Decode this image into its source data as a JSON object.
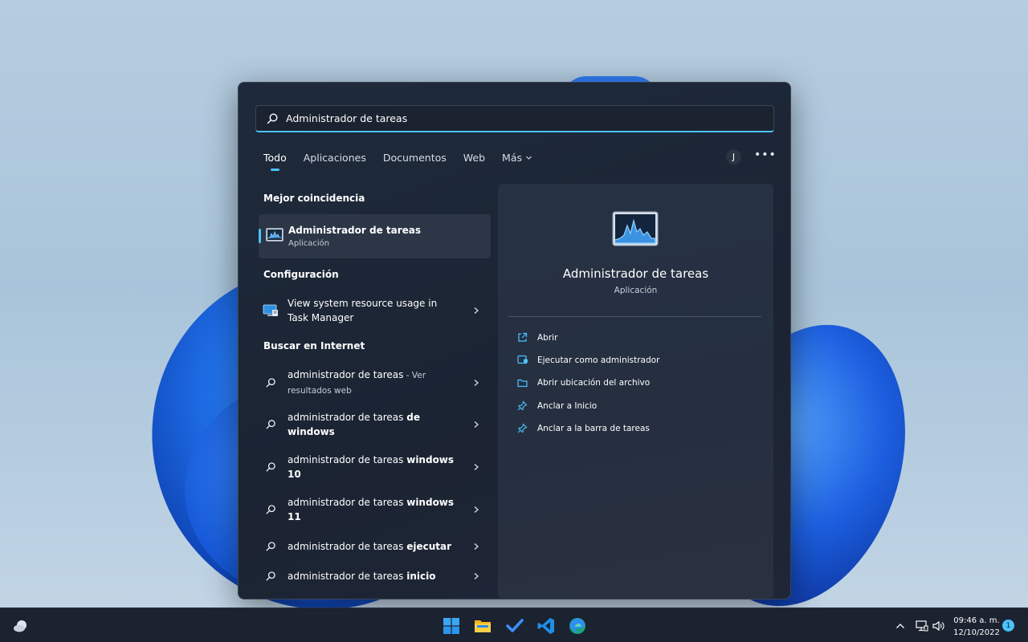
{
  "search": {
    "value": "Administrador de tareas",
    "placeholder": "Administrador de tareas"
  },
  "tabs": [
    {
      "label": "Todo",
      "active": true
    },
    {
      "label": "Aplicaciones"
    },
    {
      "label": "Documentos"
    },
    {
      "label": "Web"
    },
    {
      "label": "Más"
    }
  ],
  "account": {
    "initial": "J"
  },
  "more_label": "•••",
  "results": {
    "best_match_title": "Mejor coincidencia",
    "best_match": {
      "name": "Administrador de tareas",
      "type": "Aplicación"
    },
    "settings_title": "Configuración",
    "settings_item": {
      "line1": "View system resource usage in",
      "line2": "Task Manager"
    },
    "web_title": "Buscar en Internet",
    "web": [
      {
        "prefix": "administrador de tareas",
        "bold": "",
        "dim": " - Ver resultados web"
      },
      {
        "prefix": "administrador de tareas ",
        "bold": "de windows",
        "dim": ""
      },
      {
        "prefix": "administrador de tareas ",
        "bold": "windows 10",
        "dim": ""
      },
      {
        "prefix": "administrador de tareas ",
        "bold": "windows 11",
        "dim": ""
      },
      {
        "prefix": "administrador de tareas ",
        "bold": "ejecutar",
        "dim": ""
      },
      {
        "prefix": "administrador de tareas ",
        "bold": "inicio",
        "dim": ""
      }
    ]
  },
  "preview": {
    "title": "Administrador de tareas",
    "subtitle": "Aplicación",
    "actions": [
      {
        "label": "Abrir",
        "icon": "open-external-icon"
      },
      {
        "label": "Ejecutar como administrador",
        "icon": "admin-shield-icon"
      },
      {
        "label": "Abrir ubicación del archivo",
        "icon": "folder-icon"
      },
      {
        "label": "Anclar a Inicio",
        "icon": "pin-icon"
      },
      {
        "label": "Anclar a la barra de tareas",
        "icon": "pin-icon"
      }
    ]
  },
  "taskbar": {
    "apps": [
      "windows-start-icon",
      "file-explorer-icon",
      "todo-icon",
      "vscode-icon",
      "edge-icon"
    ],
    "time": "09:46 a. m.",
    "date": "12/10/2022",
    "notifications": "1"
  },
  "colors": {
    "accent": "#4cc2ff",
    "panel": "#1e2a3b"
  }
}
